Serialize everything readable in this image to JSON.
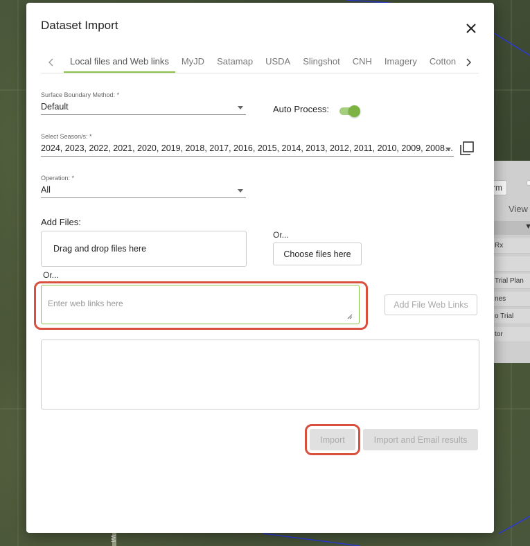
{
  "dialog": {
    "title": "Dataset Import",
    "tabs": [
      {
        "label": "Local files and Web links",
        "active": true
      },
      {
        "label": "MyJD"
      },
      {
        "label": "Satamap"
      },
      {
        "label": "USDA"
      },
      {
        "label": "Slingshot"
      },
      {
        "label": "CNH"
      },
      {
        "label": "Imagery"
      },
      {
        "label": "Cotton"
      }
    ],
    "surface_boundary": {
      "label": "Surface Boundary Method: *",
      "value": "Default"
    },
    "auto_process": {
      "label": "Auto Process:",
      "enabled": true
    },
    "season": {
      "label": "Select Season/s: *",
      "value": "2024, 2023, 2022, 2021, 2020, 2019, 2018, 2017, 2016, 2015, 2014, 2013, 2012, 2011, 2010, 2009, 2008…"
    },
    "operation": {
      "label": "Operation: *",
      "value": "All"
    },
    "add_files": {
      "label": "Add Files:",
      "dropzone_text": "Drag and drop files here",
      "or_text": "Or...",
      "choose_button": "Choose files here"
    },
    "web_links": {
      "or_text": "Or...",
      "placeholder": "Enter web links here",
      "add_button": "Add File Web Links"
    },
    "actions": {
      "import_button": "Import",
      "import_email_button": "Import and Email results"
    }
  },
  "side_panel": {
    "button_1": "rm",
    "view_label": "View",
    "rows": [
      "Rx",
      "",
      "Trial Plan",
      "nes",
      "o Trial",
      "tor"
    ]
  },
  "map": {
    "road_label": "Wi"
  },
  "colors": {
    "accent": "#8bc34a",
    "highlight": "#d9503f",
    "toggle": "#7cb342"
  }
}
